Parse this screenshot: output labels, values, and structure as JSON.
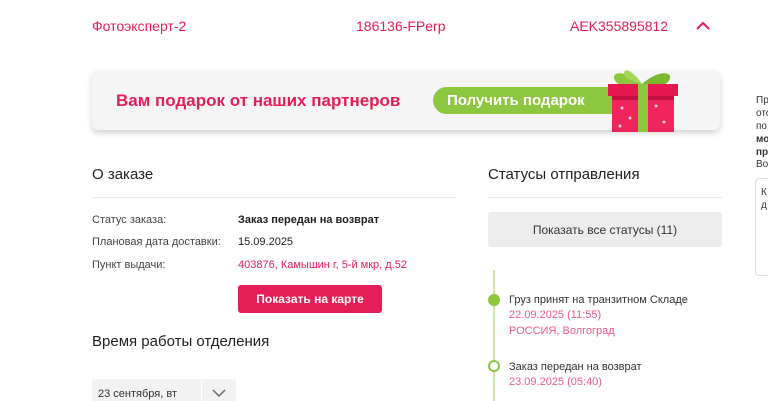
{
  "order_row": {
    "shop": "Фотоэксперт-2",
    "order_number": "186136-FPerp",
    "tracking": "AEK355895812"
  },
  "banner": {
    "text": "Вам подарок от наших партнеров",
    "button_label": "Получить подарок"
  },
  "order_info": {
    "title": "О заказе",
    "rows": [
      {
        "label": "Статус заказа:",
        "value": "Заказ передан на возврат"
      },
      {
        "label": "Плановая дата доставки:",
        "value": "15.09.2025"
      },
      {
        "label": "Пункт выдачи:",
        "value": "403876, Камышин г, 5-й мкр, д.52"
      }
    ],
    "map_button": "Показать на карте"
  },
  "hours": {
    "title": "Время работы отделения",
    "date_value": "23 сентября, вт"
  },
  "statuses": {
    "title": "Статусы отправления",
    "show_all_button": "Показать все статусы (11)",
    "items": [
      {
        "title": "Груз принят на транзитном Складе",
        "date": "22.09.2025 (11:55)",
        "location": "РОССИЯ, Волгоград"
      },
      {
        "title": "Заказ передан на возврат",
        "date": "23.09.2025 (05:40)"
      }
    ]
  },
  "side": {
    "lines": [
      "Пр",
      "отс",
      "по",
      "мо",
      "пр",
      "Во"
    ],
    "card_lines": [
      "К",
      "д"
    ]
  },
  "colors": {
    "accent": "#e41e56",
    "green": "#8dc63f"
  }
}
